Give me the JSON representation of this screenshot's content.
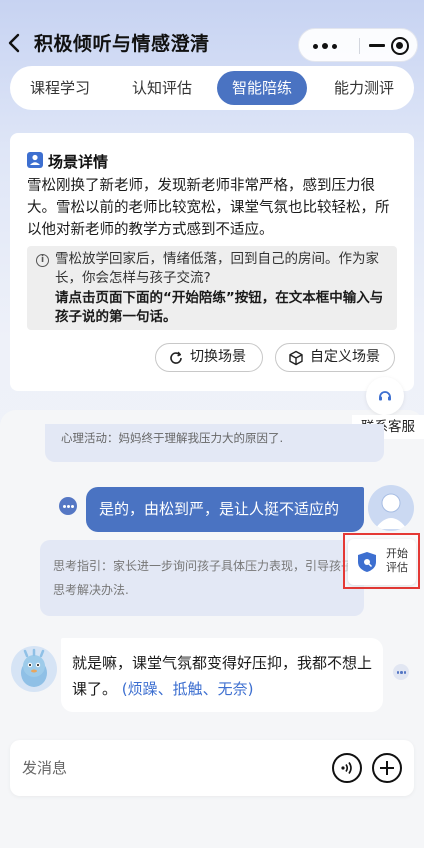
{
  "header": {
    "title": "积极倾听与情感澄清",
    "back_icon": "chevron-left-icon",
    "capsule_icons": [
      "more-dots-icon",
      "minimize-icon",
      "close-circle-icon"
    ]
  },
  "tabs": [
    {
      "label": "课程学习",
      "active": false
    },
    {
      "label": "认知评估",
      "active": false
    },
    {
      "label": "智能陪练",
      "active": true
    },
    {
      "label": "能力测评",
      "active": false
    }
  ],
  "scene": {
    "title": "场景详情",
    "description": "雪松刚换了新老师，发现新老师非常严格，感到压力很大。雪松以前的老师比较宽松，课堂气氛也比较轻松，所以他对新老师的教学方式感到不适应。",
    "hint": "雪松放学回家后，情绪低落，回到自己的房间。作为家长，你会怎样与孩子交流?",
    "instruction": "请点击页面下面的“开始陪练”按钮，在文本框中输入与孩子说的第一句话。",
    "switch_button": "切换场景",
    "custom_button": "自定义场景"
  },
  "support": {
    "label": "联系客服"
  },
  "chat": {
    "thought": "心理活动：妈妈终于理解我压力大的原因了.",
    "user_message": "是的，由松到严，是让人挺不适应的",
    "guide": "思考指引：家长进一步询问孩子具体压力表现，引导孩子思考解决办法.",
    "ai_message": "就是嘛，课堂气氛都变得好压抑，我都不想上课了。",
    "ai_emotion": "(烦躁、抵触、无奈)"
  },
  "eval_button": {
    "label": "开始评估"
  },
  "input": {
    "placeholder": "发消息"
  },
  "colors": {
    "accent": "#4a73c2",
    "highlight": "#e53935",
    "bubble": "#e3e8f5"
  }
}
